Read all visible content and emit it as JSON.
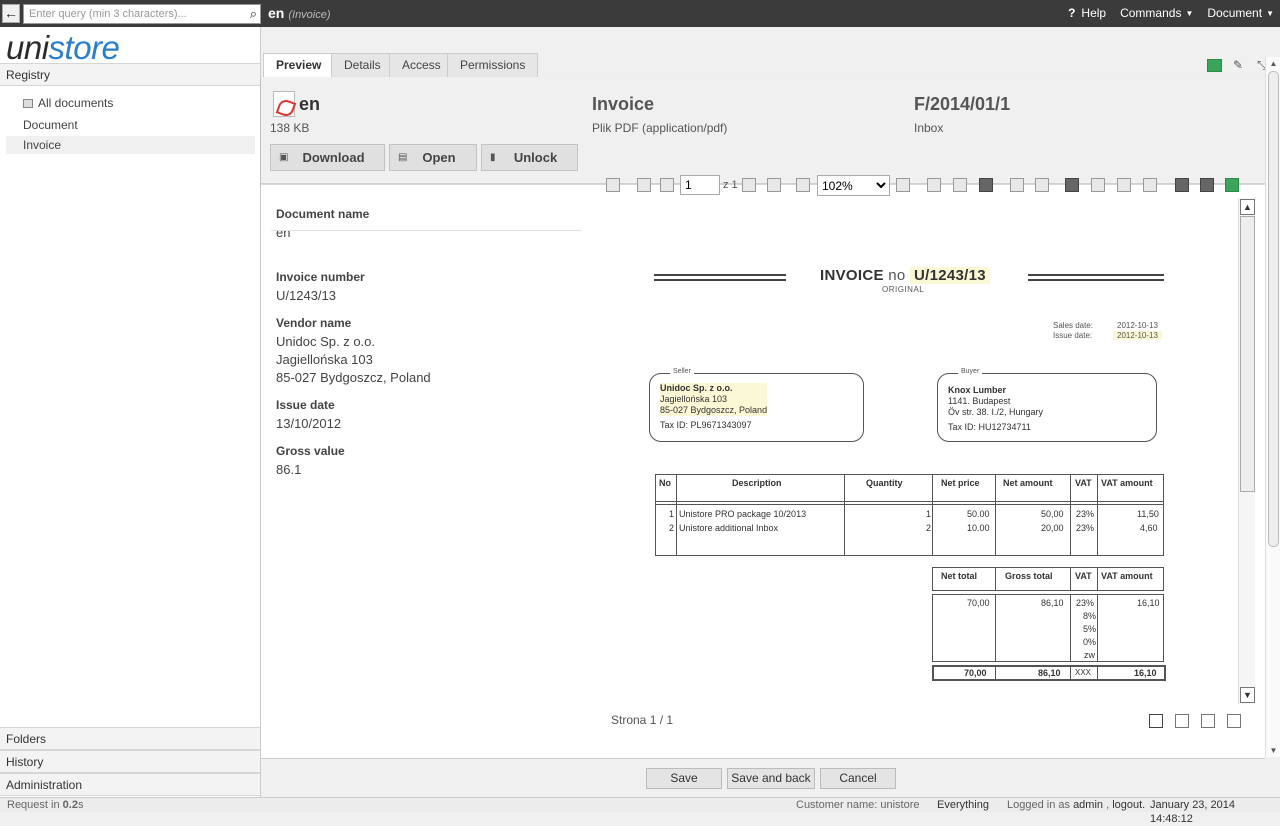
{
  "topbar": {
    "back_label": "←",
    "search_placeholder": "Enter query (min 3 characters)...",
    "search_icon": "⌕",
    "doc_name": "en",
    "doc_type": "(Invoice)",
    "help_q": "?",
    "help_label": "Help",
    "commands_label": "Commands",
    "document_label": "Document"
  },
  "sidebar": {
    "logo_part1": "uni",
    "logo_part2": "store",
    "registry_label": "Registry",
    "items": [
      {
        "label": "All documents"
      },
      {
        "label": "Document"
      },
      {
        "label": "Invoice"
      }
    ],
    "folders_label": "Folders",
    "history_label": "History",
    "administration_label": "Administration"
  },
  "tabs": [
    {
      "label": "Preview"
    },
    {
      "label": "Details"
    },
    {
      "label": "Access"
    },
    {
      "label": "Permissions"
    }
  ],
  "header": {
    "name": "en",
    "size": "138 KB",
    "download_label": "Download",
    "open_label": "Open",
    "unlock_label": "Unlock",
    "type_title": "Invoice",
    "mime": "Plik PDF (application/pdf)",
    "number_title": "F/2014/01/1",
    "location": "Inbox"
  },
  "fields": {
    "doc_name_label": "Document name",
    "doc_name_value": "en",
    "invoice_number_label": "Invoice number",
    "invoice_number_value": "U/1243/13",
    "vendor_name_label": "Vendor name",
    "vendor_line1": "Unidoc Sp. z o.o.",
    "vendor_line2": "Jagiellońska 103",
    "vendor_line3": "85-027 Bydgoszcz, Poland",
    "issue_date_label": "Issue date",
    "issue_date_value": "13/10/2012",
    "gross_value_label": "Gross value",
    "gross_value_value": "86.1"
  },
  "viewer": {
    "page_value": "1",
    "page_of": "z 1",
    "zoom": "102%",
    "page_status": "Strona 1 / 1"
  },
  "invoice": {
    "title_prefix": "INVOICE",
    "title_no": "no",
    "title_number": "U/1243/13",
    "original": "ORIGINAL",
    "sales_date_label": "Sales date:",
    "sales_date": "2012-10-13",
    "issue_date_label": "Issue date:",
    "issue_date": "2012-10-13",
    "seller_caption": "Seller",
    "seller_name": "Unidoc Sp. z o.o.",
    "seller_street": "Jagiellońska 103",
    "seller_city": "85-027 Bydgoszcz, Poland",
    "seller_tax": "Tax ID: PL9671343097",
    "buyer_caption": "Buyer",
    "buyer_name": "Knox Lumber",
    "buyer_street": "1141. Budapest",
    "buyer_city": "Öv str. 38. I./2, Hungary",
    "buyer_tax": "Tax ID: HU12734711",
    "headers": [
      "No",
      "Description",
      "Quantity",
      "Net price",
      "Net amount",
      "VAT",
      "VAT amount"
    ],
    "rows": [
      [
        "1",
        "Unistore PRO package 10/2013",
        "1",
        "50.00",
        "50,00",
        "23%",
        "11,50"
      ],
      [
        "2",
        "Unistore additional Inbox",
        "2",
        "10.00",
        "20,00",
        "23%",
        "4,60"
      ]
    ],
    "sum_headers": [
      "Net total",
      "Gross total",
      "VAT",
      "VAT amount"
    ],
    "sum_row": [
      "70,00",
      "86,10",
      "23%",
      "16,10"
    ],
    "vat_rates": [
      "8%",
      "5%",
      "0%",
      "zw"
    ],
    "total_row": [
      "70,00",
      "86,10",
      "XXX",
      "16,10"
    ]
  },
  "footer": {
    "save_label": "Save",
    "save_back_label": "Save and back",
    "cancel_label": "Cancel"
  },
  "status": {
    "request_prefix": "Request in",
    "request_time": "0.2",
    "request_unit": "s",
    "customer": "Customer name: unistore",
    "scope": "Everything",
    "logged_prefix": "Logged in as",
    "user": "admin",
    "logout": "logout.",
    "datetime": "January 23, 2014 14:48:12"
  }
}
